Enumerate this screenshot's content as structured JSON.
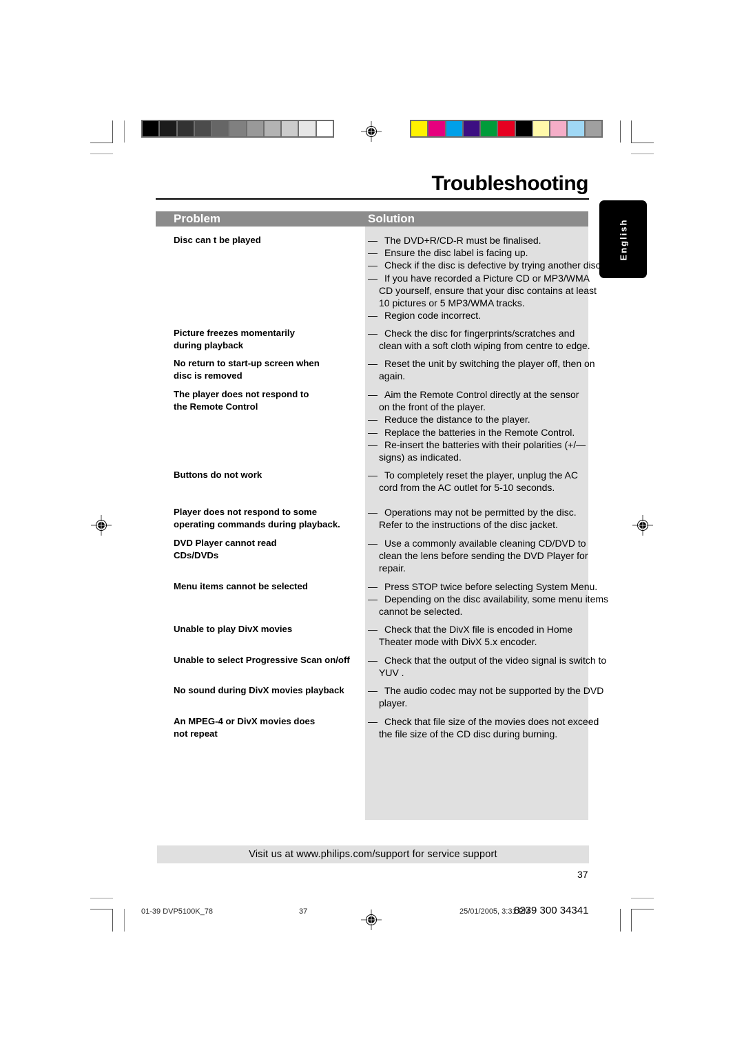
{
  "color_bars": {
    "grayscale": [
      "#000000",
      "#1c1c1c",
      "#333333",
      "#4c4c4c",
      "#666666",
      "#808080",
      "#999999",
      "#b3b3b3",
      "#cccccc",
      "#e6e6e6",
      "#ffffff"
    ],
    "process": [
      "#fff200",
      "#e6007e",
      "#00a0e9",
      "#3c0f82",
      "#009b3a",
      "#e60021",
      "#000000",
      "#fff9aa",
      "#f5aec8",
      "#a0d8f5",
      "#a0a0a0"
    ]
  },
  "page": {
    "title": "Troubleshooting",
    "language_tab": "English",
    "header": {
      "problem": "Problem",
      "solution": "Solution"
    },
    "rows": [
      {
        "problem": [
          "Disc can t be played"
        ],
        "solutions": [
          {
            "dash": true,
            "lines": [
              "The DVD+R/CD-R must be finalised."
            ]
          },
          {
            "dash": true,
            "lines": [
              "Ensure the disc label is facing up."
            ]
          },
          {
            "dash": true,
            "lines": [
              "Check if the disc is defective by trying another disc."
            ]
          },
          {
            "dash": true,
            "lines": [
              "If you have recorded a Picture CD or MP3/WMA",
              "CD yourself, ensure that your disc contains at least",
              "10 pictures or 5 MP3/WMA tracks."
            ]
          },
          {
            "dash": true,
            "lines": [
              "Region code incorrect."
            ]
          }
        ]
      },
      {
        "problem": [
          "Picture freezes momentarily",
          "during playback"
        ],
        "solutions": [
          {
            "dash": true,
            "lines": [
              "Check the disc for fingerprints/scratches and",
              "clean with a soft cloth wiping from centre to edge."
            ]
          }
        ]
      },
      {
        "problem": [
          "No return to start-up screen when",
          "disc is removed"
        ],
        "solutions": [
          {
            "dash": true,
            "lines": [
              "Reset the unit by switching the player off, then on",
              "again."
            ]
          }
        ]
      },
      {
        "problem": [
          "The player does not respond to",
          "the Remote Control"
        ],
        "solutions": [
          {
            "dash": true,
            "lines": [
              "Aim the Remote Control directly at the sensor",
              "on the front of the player."
            ]
          },
          {
            "dash": true,
            "lines": [
              "Reduce the distance to the player."
            ]
          },
          {
            "dash": true,
            "lines": [
              "Replace the batteries in the Remote Control."
            ]
          },
          {
            "dash": true,
            "lines": [
              "Re-insert the batteries with their polarities (+/—",
              "signs) as indicated."
            ]
          }
        ]
      },
      {
        "problem": [
          "Buttons do not work"
        ],
        "solutions": [
          {
            "dash": true,
            "lines": [
              "To completely reset the player, unplug the AC",
              "cord from the AC outlet for 5-10 seconds."
            ]
          }
        ]
      },
      {
        "problem": [
          "Player does not respond to some",
          "operating commands during playback."
        ],
        "solutions": [
          {
            "dash": true,
            "lines": [
              "Operations may not be permitted by the disc.",
              "Refer to the instructions of  the disc jacket."
            ]
          }
        ]
      },
      {
        "problem": [
          "DVD Player cannot read",
          "CDs/DVDs"
        ],
        "solutions": [
          {
            "dash": true,
            "lines": [
              "Use a commonly available cleaning CD/DVD to",
              "clean the lens before sending the DVD Player for",
              "repair."
            ]
          }
        ]
      },
      {
        "problem": [
          "Menu items cannot be selected"
        ],
        "solutions": [
          {
            "dash": true,
            "lines": [
              "Press STOP twice before selecting System Menu."
            ]
          },
          {
            "dash": true,
            "lines": [
              "Depending on the disc availability, some menu items",
              "cannot be selected."
            ]
          }
        ]
      },
      {
        "problem": [
          "Unable to play DivX movies"
        ],
        "solutions": [
          {
            "dash": true,
            "lines": [
              "Check that the DivX file is encoded in  Home",
              "Theater  mode with DivX 5.x encoder."
            ]
          }
        ]
      },
      {
        "problem": [
          "Unable to select Progressive Scan on/off"
        ],
        "solutions": [
          {
            "dash": true,
            "lines": [
              "Check that the output of the video signal is switch to",
              " YUV ."
            ]
          }
        ]
      },
      {
        "problem": [
          "No sound during DivX movies playback"
        ],
        "solutions": [
          {
            "dash": true,
            "lines": [
              "The audio codec may not be supported by the DVD",
              "player."
            ]
          }
        ]
      },
      {
        "problem": [
          "An MPEG-4 or DivX movies does",
          "not repeat"
        ],
        "solutions": [
          {
            "dash": true,
            "lines": [
              "Check that file size of the movies does not exceed",
              "the file size of the CD disc during burning."
            ]
          }
        ]
      }
    ],
    "footer_text": "Visit us at www.philips.com/support for service support",
    "page_number": "37"
  },
  "slug": {
    "file": "01-39 DVP5100K_78",
    "page": "37",
    "date": "25/01/2005, 3:31 PM",
    "code": "8239 300 34341"
  }
}
